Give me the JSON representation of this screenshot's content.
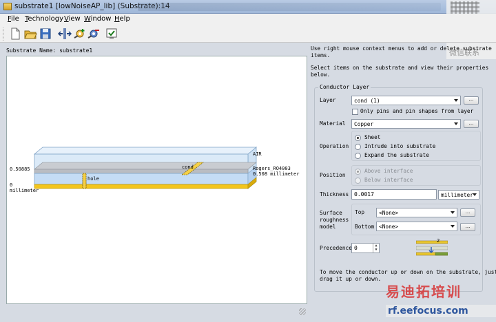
{
  "window": {
    "title": "substrate1 [lowNoiseAP_lib] (Substrate):14"
  },
  "menu": [
    "File",
    "Technology",
    "View",
    "Window",
    "Help"
  ],
  "toolbar": {
    "icons": [
      "new-document-icon",
      "open-folder-icon",
      "save-icon",
      "insert-layer-icon",
      "add-layer-icon",
      "remove-layer-icon",
      "check-icon"
    ]
  },
  "left": {
    "substrate_name_label": "Substrate Name:",
    "substrate_name": "substrate1",
    "diagram": {
      "air": "AIR",
      "top_height": "0.50885",
      "bottom_height": "0",
      "bottom_unit": "millimeter",
      "hole": "hole",
      "cond": "cond",
      "material": "Rogers_RO4003",
      "thickness": "0.508 millimeter"
    }
  },
  "right": {
    "help1_line1": "Use right mouse context menus to add or delete substrate",
    "help1_line2": "items.",
    "help2_line1": "Select items on the substrate and view their properties",
    "help2_line2": "below.",
    "group_title": "Conductor Layer",
    "layer_label": "Layer",
    "layer_value": "cond (1)",
    "dots": "...",
    "only_pins": "Only pins and pin shapes from layer",
    "material_label": "Material",
    "material_value": "Copper",
    "operation_label": "Operation",
    "operations": [
      "Sheet",
      "Intrude into substrate",
      "Expand the substrate"
    ],
    "position_label": "Position",
    "positions": [
      "Above interface",
      "Below interface"
    ],
    "thickness_label": "Thickness",
    "thickness_value": "0.0017",
    "thickness_unit": "millimeter",
    "roughness_label_1": "Surface",
    "roughness_label_2": "roughness",
    "roughness_label_3": "model",
    "top_label": "Top",
    "top_value": "<None>",
    "bottom_label": "Bottom",
    "bottom_value": "<None>",
    "precedence_label": "Precedence",
    "precedence_value": "0",
    "precedence_badge": "2",
    "footer_line1": "To move the conductor up or down on the substrate, just",
    "footer_line2": "drag it up or down."
  },
  "watermark": {
    "side_text": "微信联系",
    "brand": "易迪拓培训",
    "url": "rf.eefocus.com"
  }
}
